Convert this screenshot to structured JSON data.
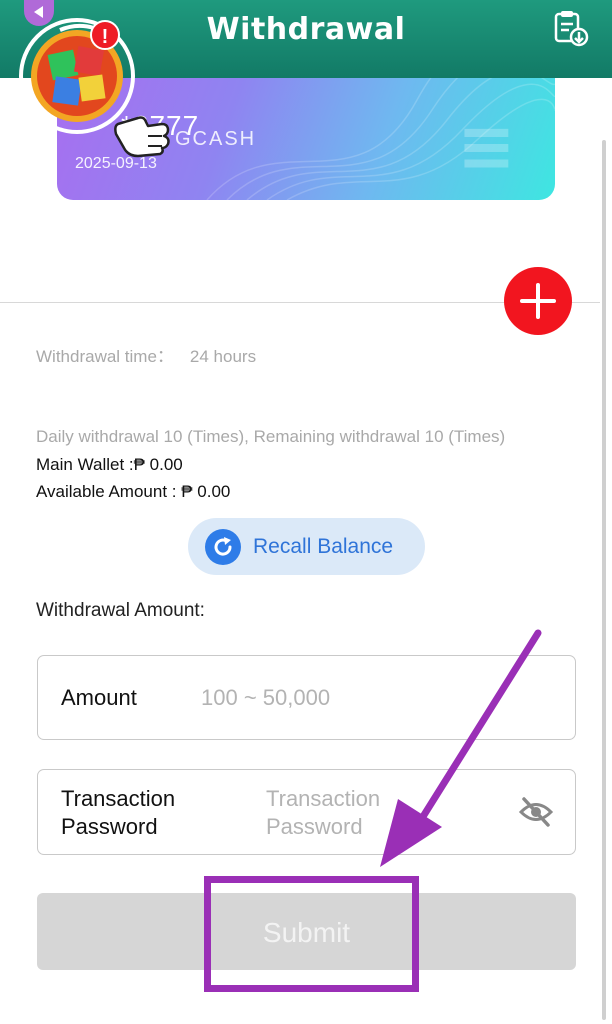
{
  "header": {
    "title": "Withdrawal",
    "icon": "clipboard-download-icon"
  },
  "card": {
    "brand": "GCASH",
    "masked_number": "*6777",
    "date": "2025-09-13"
  },
  "badge": {
    "alert_symbol": "!"
  },
  "info": {
    "withdrawal_time_label": "Withdrawal time：",
    "withdrawal_time_value": "24 hours",
    "daily_limit": "Daily withdrawal 10 (Times), Remaining withdrawal 10 (Times)",
    "main_wallet": "Main Wallet :₱ 0.00",
    "available_amount": "Available Amount : ₱ 0.00"
  },
  "recall": {
    "label": "Recall Balance"
  },
  "form": {
    "heading": "Withdrawal Amount:",
    "amount_label": "Amount",
    "amount_placeholder": "100 ~ 50,000",
    "password_label": "Transaction Password",
    "password_placeholder": "Transaction Password"
  },
  "submit": {
    "label": "Submit"
  },
  "colors": {
    "header": "#1f9a7e",
    "accent_red": "#f2151f",
    "recall_blue": "#2e7ce8",
    "annotation_purple": "#9a2fb6",
    "submit_disabled": "#d6d6d6"
  }
}
